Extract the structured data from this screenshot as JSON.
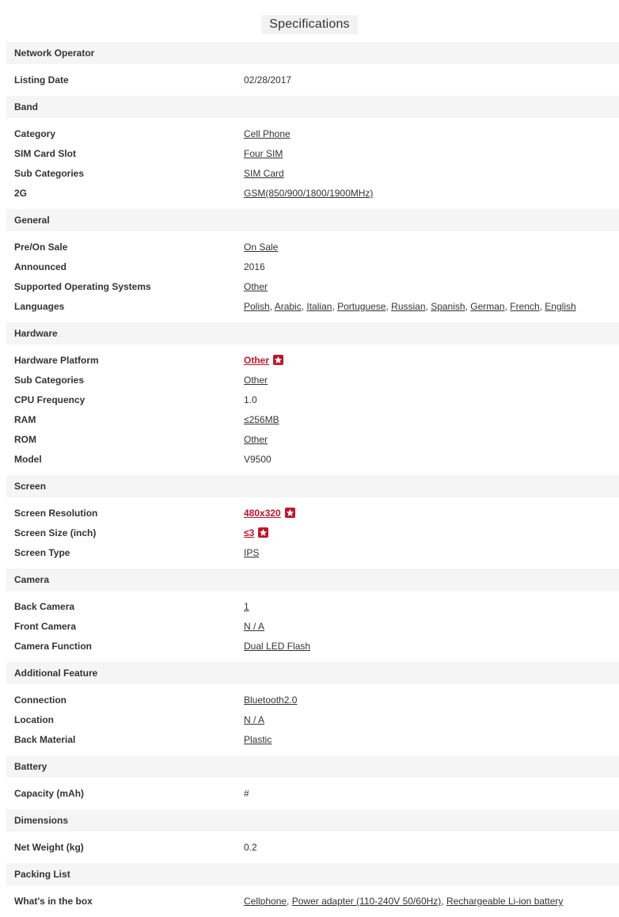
{
  "title": "Specifications",
  "sections": [
    {
      "header": "Network Operator",
      "rows": [
        {
          "key": "Listing Date",
          "values": [
            {
              "text": "02/28/2017",
              "link": false
            }
          ]
        }
      ]
    },
    {
      "header": "Band",
      "rows": [
        {
          "key": "Category",
          "values": [
            {
              "text": "Cell Phone",
              "link": true
            }
          ]
        },
        {
          "key": "SIM Card Slot",
          "values": [
            {
              "text": "Four SIM",
              "link": true
            }
          ]
        },
        {
          "key": "Sub Categories",
          "values": [
            {
              "text": "SIM Card",
              "link": true
            }
          ]
        },
        {
          "key": "2G",
          "values": [
            {
              "text": "GSM(850/900/1800/1900MHz)",
              "link": true
            }
          ]
        }
      ]
    },
    {
      "header": "General",
      "rows": [
        {
          "key": "Pre/On Sale",
          "values": [
            {
              "text": "On Sale",
              "link": true
            }
          ]
        },
        {
          "key": "Announced",
          "values": [
            {
              "text": "2016",
              "link": false
            }
          ]
        },
        {
          "key": "Supported Operating Systems",
          "values": [
            {
              "text": "Other",
              "link": true
            }
          ]
        },
        {
          "key": "Languages",
          "values": [
            {
              "text": "Polish",
              "link": true
            },
            {
              "text": "Arabic",
              "link": true
            },
            {
              "text": "Italian",
              "link": true
            },
            {
              "text": "Portuguese",
              "link": true
            },
            {
              "text": "Russian",
              "link": true
            },
            {
              "text": "Spanish",
              "link": true
            },
            {
              "text": "German",
              "link": true
            },
            {
              "text": "French",
              "link": true
            },
            {
              "text": "English",
              "link": true
            }
          ]
        }
      ]
    },
    {
      "header": "Hardware",
      "rows": [
        {
          "key": "Hardware Platform",
          "values": [
            {
              "text": "Other",
              "link": true,
              "hot": true
            }
          ]
        },
        {
          "key": "Sub Categories",
          "values": [
            {
              "text": "Other",
              "link": true
            }
          ]
        },
        {
          "key": "CPU Frequency",
          "values": [
            {
              "text": "1.0",
              "link": false
            }
          ]
        },
        {
          "key": "RAM",
          "values": [
            {
              "text": "≤256MB",
              "link": true
            }
          ]
        },
        {
          "key": "ROM",
          "values": [
            {
              "text": "Other",
              "link": true
            }
          ]
        },
        {
          "key": "Model",
          "values": [
            {
              "text": "V9500",
              "link": false
            }
          ]
        }
      ]
    },
    {
      "header": "Screen",
      "rows": [
        {
          "key": "Screen Resolution",
          "values": [
            {
              "text": "480x320",
              "link": true,
              "hot": true
            }
          ]
        },
        {
          "key": "Screen Size (inch)",
          "values": [
            {
              "text": "≤3",
              "link": true,
              "hot": true
            }
          ]
        },
        {
          "key": "Screen Type",
          "values": [
            {
              "text": "IPS",
              "link": true
            }
          ]
        }
      ]
    },
    {
      "header": "Camera",
      "rows": [
        {
          "key": "Back Camera",
          "values": [
            {
              "text": "1",
              "link": true
            }
          ]
        },
        {
          "key": "Front Camera",
          "values": [
            {
              "text": "N / A",
              "link": true
            }
          ]
        },
        {
          "key": "Camera Function",
          "values": [
            {
              "text": "Dual LED Flash",
              "link": true
            }
          ]
        }
      ]
    },
    {
      "header": "Additional Feature",
      "rows": [
        {
          "key": "Connection",
          "values": [
            {
              "text": "Bluetooth2.0",
              "link": true
            }
          ]
        },
        {
          "key": "Location",
          "values": [
            {
              "text": "N / A",
              "link": true
            }
          ]
        },
        {
          "key": "Back Material",
          "values": [
            {
              "text": "Plastic",
              "link": true
            }
          ]
        }
      ]
    },
    {
      "header": "Battery",
      "rows": [
        {
          "key": "Capacity (mAh)",
          "values": [
            {
              "text": "#",
              "link": false
            }
          ]
        }
      ]
    },
    {
      "header": "Dimensions",
      "rows": [
        {
          "key": "Net Weight (kg)",
          "values": [
            {
              "text": "0.2",
              "link": false
            }
          ]
        }
      ]
    },
    {
      "header": "Packing List",
      "rows": [
        {
          "key": "What's in the box",
          "values": [
            {
              "text": "Cellphone",
              "link": true
            },
            {
              "text": "Power adapter (110-240V 50/60Hz)",
              "link": true
            },
            {
              "text": "Rechargeable Li-ion battery",
              "link": true
            }
          ]
        }
      ]
    }
  ],
  "colors": {
    "accent": "#c0152a",
    "header_bg": "#f5f5f5",
    "title_bg": "#f2f2f2"
  },
  "icons": {
    "hot": "red-star-badge-icon"
  }
}
